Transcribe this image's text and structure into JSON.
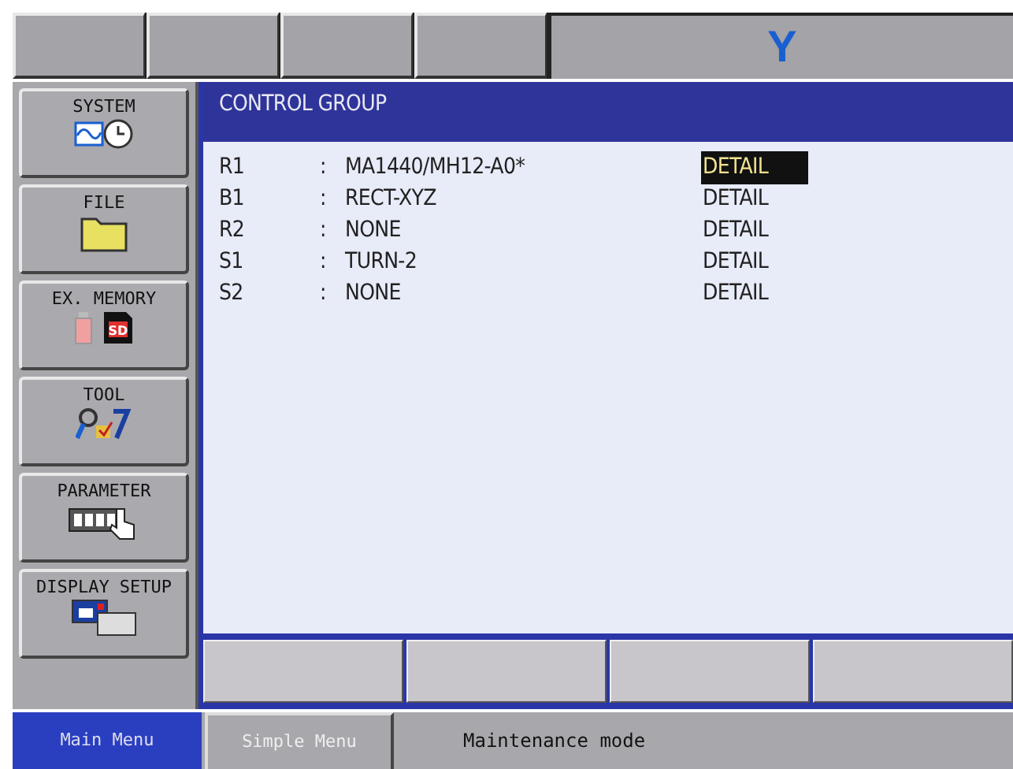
{
  "top_bar": {
    "logo": "Y"
  },
  "menu": [
    {
      "label": "SYSTEM",
      "kind": "system"
    },
    {
      "label": "FILE",
      "kind": "file"
    },
    {
      "label": "EX. MEMORY",
      "kind": "memory",
      "icon_text": "SD"
    },
    {
      "label": "TOOL",
      "kind": "tool"
    },
    {
      "label": "PARAMETER",
      "kind": "parameter"
    },
    {
      "label": "DISPLAY SETUP",
      "kind": "display"
    }
  ],
  "panel": {
    "title": "CONTROL GROUP",
    "rows": [
      {
        "group": "R1",
        "separator": ":",
        "value": "MA1440/MH12-A0*",
        "action": "DETAIL",
        "selected": true
      },
      {
        "group": "B1",
        "separator": ":",
        "value": "RECT-XYZ",
        "action": "DETAIL",
        "selected": false
      },
      {
        "group": "R2",
        "separator": ":",
        "value": "NONE",
        "action": "DETAIL",
        "selected": false
      },
      {
        "group": "S1",
        "separator": ":",
        "value": "TURN-2",
        "action": "DETAIL",
        "selected": false
      },
      {
        "group": "S2",
        "separator": ":",
        "value": "NONE",
        "action": "DETAIL",
        "selected": false
      }
    ]
  },
  "bottom_bar": {
    "tabs": [
      {
        "label": "Main Menu",
        "selected": true
      },
      {
        "label": "Simple Menu",
        "selected": false
      }
    ],
    "status": "Maintenance mode"
  }
}
